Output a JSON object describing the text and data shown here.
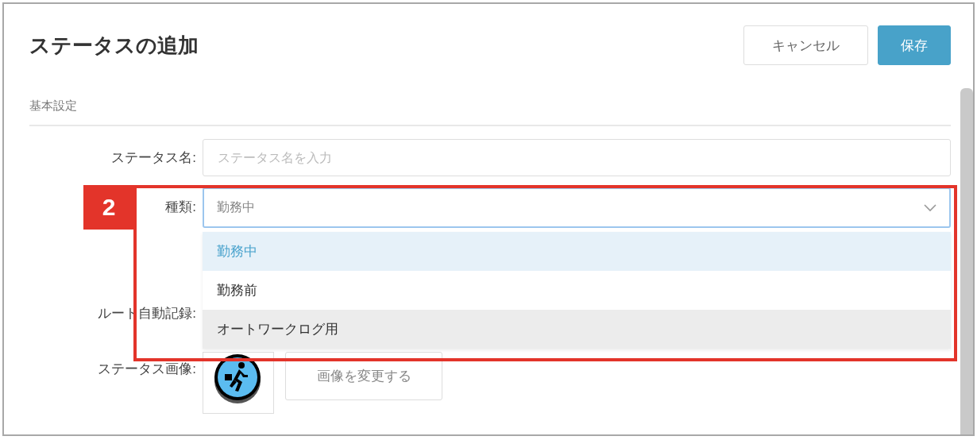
{
  "dialog": {
    "title": "ステータスの追加",
    "buttons": [
      {
        "label": "キャンセル",
        "kind": "secondary"
      },
      {
        "label": "保存",
        "kind": "primary"
      }
    ]
  },
  "section": {
    "title": "基本設定"
  },
  "fields": {
    "status_name": {
      "label": "ステータス名:",
      "placeholder": "ステータス名を入力"
    },
    "type": {
      "label": "種類:",
      "placeholder": "勤務中",
      "expanded": true,
      "options": [
        {
          "label": "勤務中",
          "selected": true,
          "hovered": false
        },
        {
          "label": "勤務前",
          "selected": false,
          "hovered": false
        },
        {
          "label": "オートワークログ用",
          "selected": false,
          "hovered": true
        }
      ]
    },
    "route": {
      "label": "ルート自動記録:"
    },
    "image": {
      "label": "ステータス画像:",
      "button": "画像を変更する"
    }
  },
  "callout": {
    "number": "2"
  }
}
